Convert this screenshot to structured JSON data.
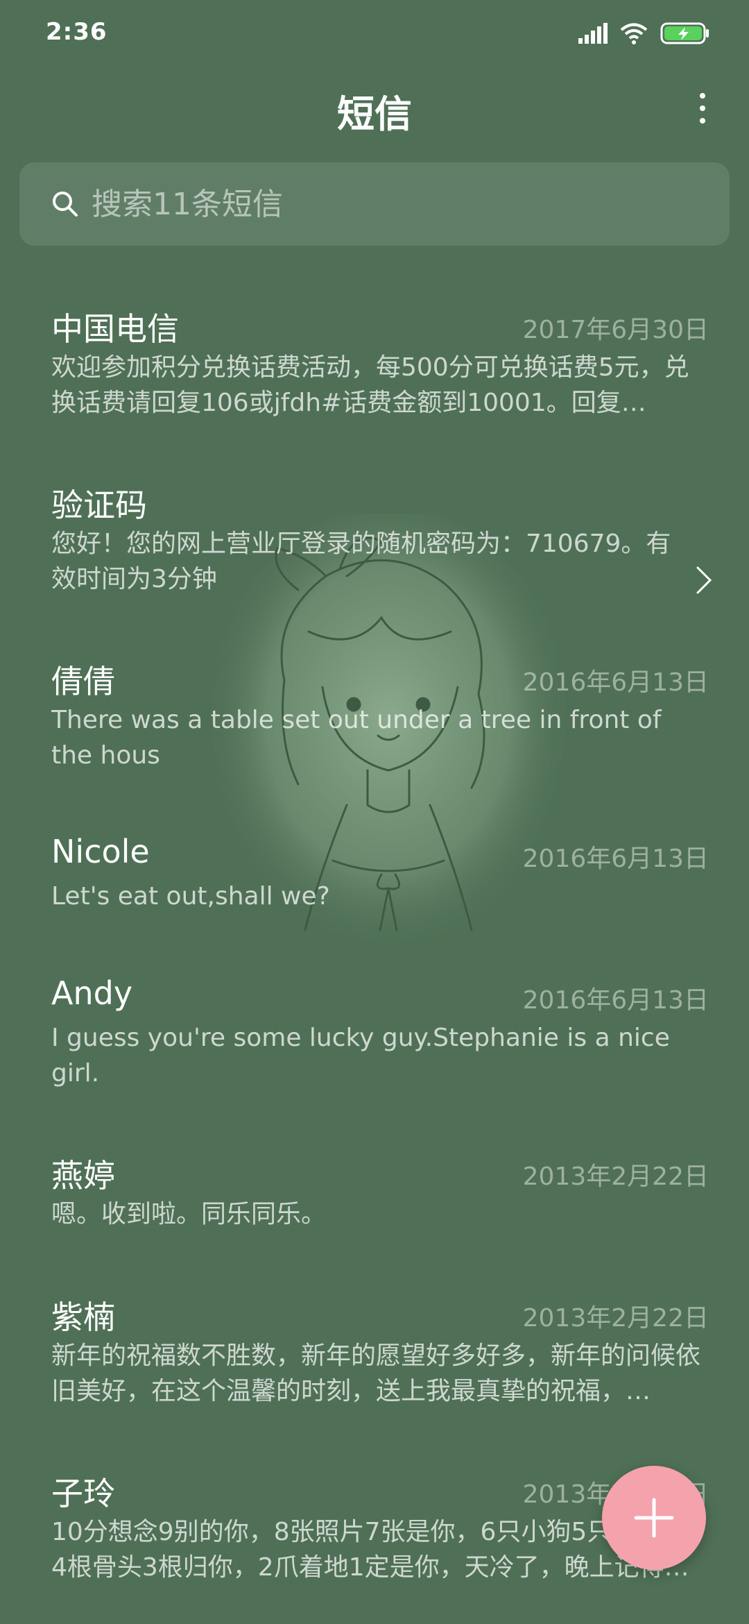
{
  "status_bar": {
    "time": "2:36",
    "icons": [
      "signal-icon",
      "wifi-icon",
      "battery-charging-icon"
    ]
  },
  "header": {
    "title": "短信",
    "menu_icon": "more-vertical-icon"
  },
  "search": {
    "placeholder": "搜索11条短信",
    "icon": "search-icon"
  },
  "conversations": [
    {
      "name": "中国电信",
      "date": "2017年6月30日",
      "preview": "欢迎参加积分兑换话费活动，每500分可兑换话费5元，兑换话费请回复106或jfdh#话费金额到10001。回复…"
    },
    {
      "name": "验证码",
      "date": "",
      "preview": "您好！您的网上营业厅登录的随机密码为：710679。有效时间为3分钟"
    },
    {
      "name": "倩倩",
      "date": "2016年6月13日",
      "preview": "There was a table set out under a tree in front of the hous"
    },
    {
      "name": "Nicole",
      "date": "2016年6月13日",
      "preview": "Let's eat out,shall we?"
    },
    {
      "name": "Andy",
      "date": "2016年6月13日",
      "preview": "I guess you're some lucky guy.Stephanie is a nice girl."
    },
    {
      "name": "燕婷",
      "date": "2013年2月22日",
      "preview": "嗯。收到啦。同乐同乐。"
    },
    {
      "name": "紫楠",
      "date": "2013年2月22日",
      "preview": "新年的祝福数不胜数，新年的愿望好多好多，新年的问候依旧美好，在这个温馨的时刻，送上我最真挚的祝福，…"
    },
    {
      "name": "子玲",
      "date": "2013年2月22日",
      "preview": "10分想念9别的你，8张照片7张是你，6只小狗5只像你，4根骨头3根归你，2爪着地1定是你，天冷了，晚上记得…"
    }
  ],
  "fab": {
    "icon": "plus-icon"
  },
  "colors": {
    "background": "#4f7056",
    "fab": "#f4a2ab",
    "text_primary": "#ffffff"
  }
}
